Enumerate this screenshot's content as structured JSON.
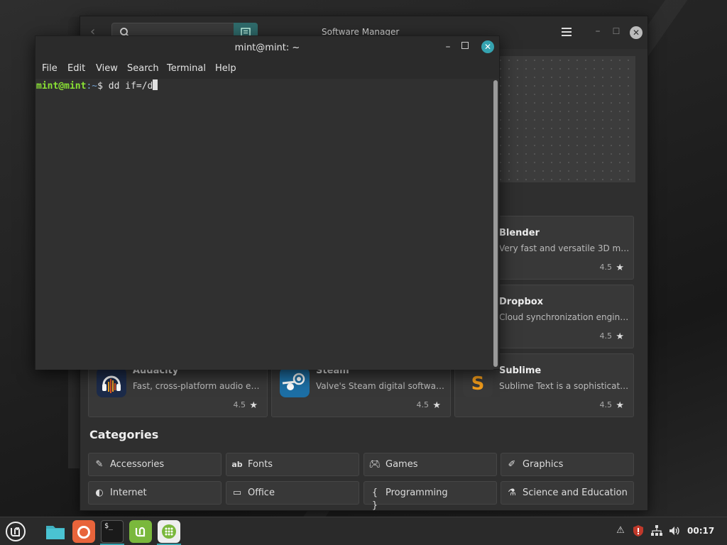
{
  "software_manager": {
    "title": "Software Manager",
    "apps": [
      {
        "name": "Blender",
        "description": "Very fast and versatile 3D mod…",
        "rating": "4.5"
      },
      {
        "name": "Dropbox",
        "description": "Cloud synchronization engine …",
        "rating": "4.5"
      },
      {
        "name": "Audacity",
        "description": "Fast, cross-platform audio editor",
        "rating": "4.5"
      },
      {
        "name": "Steam",
        "description": "Valve's Steam digital software …",
        "rating": "4.5"
      },
      {
        "name": "Sublime",
        "description": "Sublime Text is a sophisticated…",
        "rating": "4.5"
      }
    ],
    "categories_title": "Categories",
    "categories": [
      {
        "label": "Accessories",
        "icon": "puzzle-icon"
      },
      {
        "label": "Fonts",
        "icon": "ab-font-icon"
      },
      {
        "label": "Games",
        "icon": "gamepad-icon"
      },
      {
        "label": "Graphics",
        "icon": "palette-icon"
      },
      {
        "label": "Internet",
        "icon": "globe-icon"
      },
      {
        "label": "Office",
        "icon": "presentation-icon"
      },
      {
        "label": "Programming",
        "icon": "braces-icon"
      },
      {
        "label": "Science and Education",
        "icon": "flask-icon"
      }
    ]
  },
  "terminal": {
    "title": "mint@mint: ~",
    "menu": [
      "File",
      "Edit",
      "View",
      "Search",
      "Terminal",
      "Help"
    ],
    "prompt_user": "mint@mint",
    "prompt_path": ":~",
    "prompt_symbol": "$ ",
    "command": "dd if=/d"
  },
  "taskbar": {
    "apps": [
      "mint-menu-icon",
      "files-icon",
      "firefox-icon",
      "terminal-icon",
      "mintupdate-icon",
      "software-manager-icon"
    ],
    "tray": [
      "update-icon",
      "shield-icon",
      "network-icon",
      "volume-icon"
    ],
    "clock": "00:17"
  },
  "colors": {
    "accent": "#35a3b0",
    "prompt_user": "#8ae234",
    "prompt_path": "#729fcf"
  }
}
